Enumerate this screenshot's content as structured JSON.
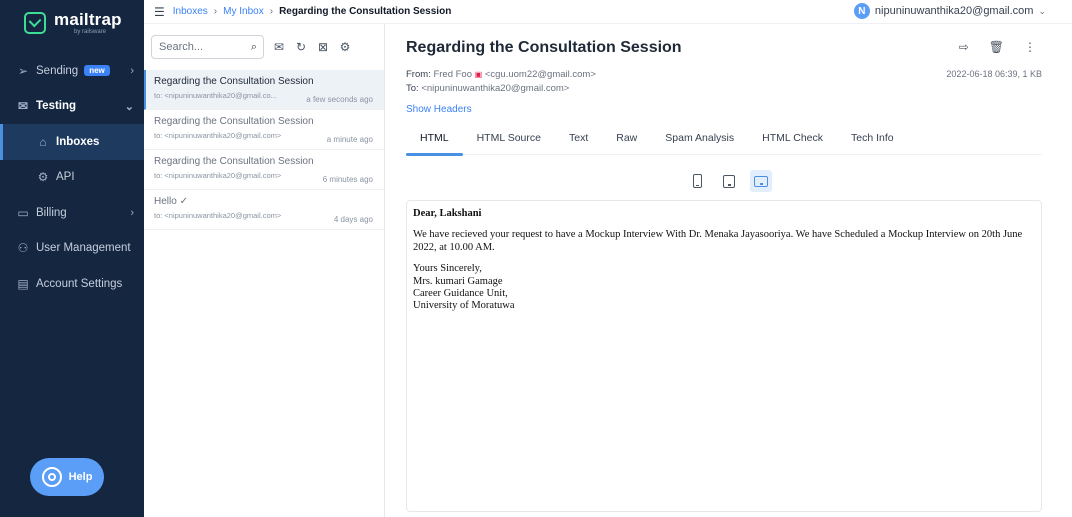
{
  "app": {
    "logo_name": "mailtrap",
    "logo_sub": "by railsware"
  },
  "sidebar": {
    "items": [
      {
        "label": "Sending",
        "badge": "new",
        "icon": "send-icon"
      },
      {
        "label": "Testing",
        "icon": "testing-icon"
      },
      {
        "label": "Inboxes",
        "icon": "inbox-icon"
      },
      {
        "label": "API",
        "icon": "api-gear-icon"
      },
      {
        "label": "Billing",
        "icon": "billing-card-icon"
      },
      {
        "label": "User Management",
        "icon": "users-icon"
      },
      {
        "label": "Account Settings",
        "icon": "account-settings-icon"
      }
    ],
    "help_label": "Help"
  },
  "topbar": {
    "breadcrumb": [
      "Inboxes",
      "My Inbox",
      "Regarding the Consultation Session"
    ],
    "account_initial": "N",
    "account_email": "nipuninuwanthika20@gmail.com"
  },
  "list": {
    "search_placeholder": "Search...",
    "messages": [
      {
        "subject": "Regarding the Consultation Session",
        "to": "to: <nipuninuwanthika20@gmail.co...",
        "time": "a few seconds ago"
      },
      {
        "subject": "Regarding the Consultation Session",
        "to": "to: <nipuninuwanthika20@gmail.com>",
        "time": "a minute ago"
      },
      {
        "subject": "Regarding the Consultation Session",
        "to": "to: <nipuninuwanthika20@gmail.com>",
        "time": "6 minutes ago"
      },
      {
        "subject": "Hello ✓",
        "to": "to: <nipuninuwanthika20@gmail.com>",
        "time": "4 days ago"
      }
    ]
  },
  "detail": {
    "title": "Regarding the Consultation Session",
    "from_label": "From:",
    "from_name": "Fred Foo",
    "from_email": "<cgu.uom22@gmail.com>",
    "to_label": "To:",
    "to_email": "<nipuninuwanthika20@gmail.com>",
    "meta": "2022-06-18 06:39, 1 KB",
    "show_headers": "Show Headers",
    "tabs": [
      "HTML",
      "HTML Source",
      "Text",
      "Raw",
      "Spam Analysis",
      "HTML Check",
      "Tech Info"
    ],
    "body": {
      "greeting": "Dear, Lakshani",
      "paragraph": "We have recieved your request to have a Mockup Interview With Dr. Menaka Jayasooriya. We have Scheduled a Mockup Interview on 20th June 2022, at 10.00 AM.",
      "signoff": [
        "Yours Sincerely,",
        "Mrs. kumari Gamage",
        "Career Guidance Unit,",
        "University of Moratuwa"
      ]
    }
  },
  "colors": {
    "sidebar_bg": "#142640",
    "accent": "#4a90e2",
    "brand_green": "#3ddc97"
  }
}
